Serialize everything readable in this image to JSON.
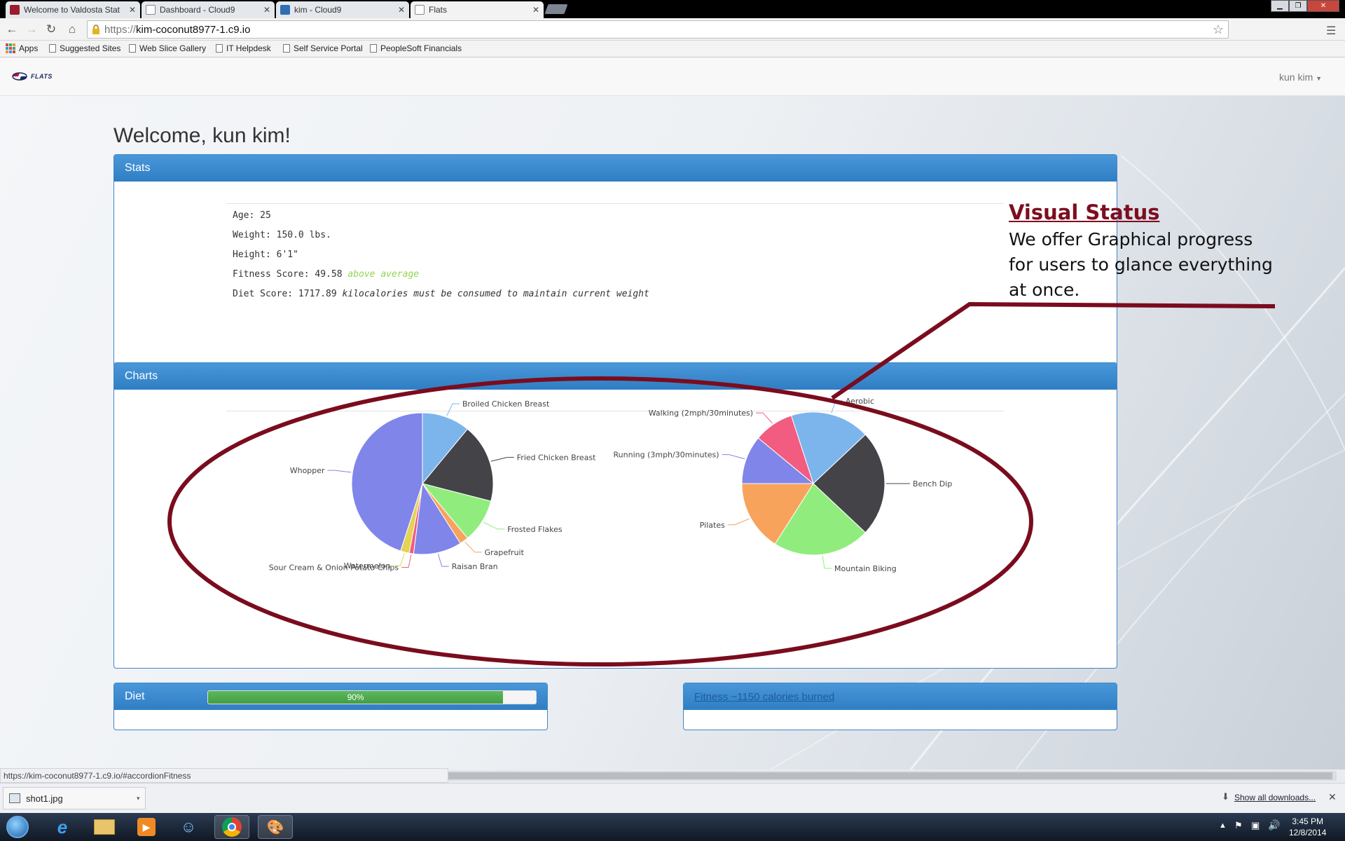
{
  "browser": {
    "tabs": [
      {
        "title": "Welcome to Valdosta Stat",
        "active": false
      },
      {
        "title": "Dashboard - Cloud9",
        "active": false
      },
      {
        "title": "kim - Cloud9",
        "active": false
      },
      {
        "title": "Flats",
        "active": true
      }
    ],
    "url_scheme": "https://",
    "url_host": "kim-coconut8977-1.c9.io",
    "bookmarks": [
      "Apps",
      "Suggested Sites",
      "Web Slice Gallery",
      "IT Helpdesk",
      "Self Service Portal",
      "PeopleSoft Financials"
    ],
    "status_url": "https://kim-coconut8977-1.c9.io/#accordionFitness",
    "download_file": "shot1.jpg",
    "show_all_downloads": "Show all downloads...",
    "clock_time": "3:45 PM",
    "clock_date": "12/8/2014"
  },
  "app": {
    "logo_text": "FLATS",
    "user_menu": "kun kim",
    "welcome": "Welcome, kun kim!"
  },
  "stats": {
    "header": "Stats",
    "age": "Age: 25",
    "weight": "Weight: 150.0 lbs.",
    "height": "Height: 6'1\"",
    "fitness_label": "Fitness Score: 49.58",
    "fitness_note": "above average",
    "diet_label": "Diet Score: 1717.89",
    "diet_note": "kilocalories must be consumed to maintain current weight"
  },
  "callout": {
    "title": "Visual Status",
    "body": "We offer Graphical progress for users to glance everything at once."
  },
  "charts_panel": {
    "header": "Charts"
  },
  "chart_data": [
    {
      "type": "pie",
      "categories": [
        "Broiled Chicken Breast",
        "Fried Chicken Breast",
        "Frosted Flakes",
        "Grapefruit",
        "Raisan Bran",
        "Sour Cream & Onion Potato Chips",
        "Watermelon",
        "Whopper"
      ],
      "values": [
        11,
        18,
        10,
        2,
        11,
        1,
        2,
        45
      ],
      "colors": [
        "#7cb5ec",
        "#434348",
        "#90ed7d",
        "#f7a35c",
        "#8085e9",
        "#f15c80",
        "#e4d354",
        "#8085e9"
      ]
    },
    {
      "type": "pie",
      "categories": [
        "Aerobic",
        "Bench Dip",
        "Mountain Biking",
        "Pilates",
        "Running (3mph/30minutes)",
        "Walking (2mph/30minutes)"
      ],
      "values": [
        18,
        24,
        22,
        16,
        11,
        9
      ],
      "colors": [
        "#7cb5ec",
        "#434348",
        "#90ed7d",
        "#f7a35c",
        "#8085e9",
        "#f15c80"
      ]
    }
  ],
  "diet_panel": {
    "header": "Diet",
    "progress": 90,
    "progress_label": "90%"
  },
  "fitness_panel": {
    "header": "Fitness ~1150 calories burned"
  }
}
